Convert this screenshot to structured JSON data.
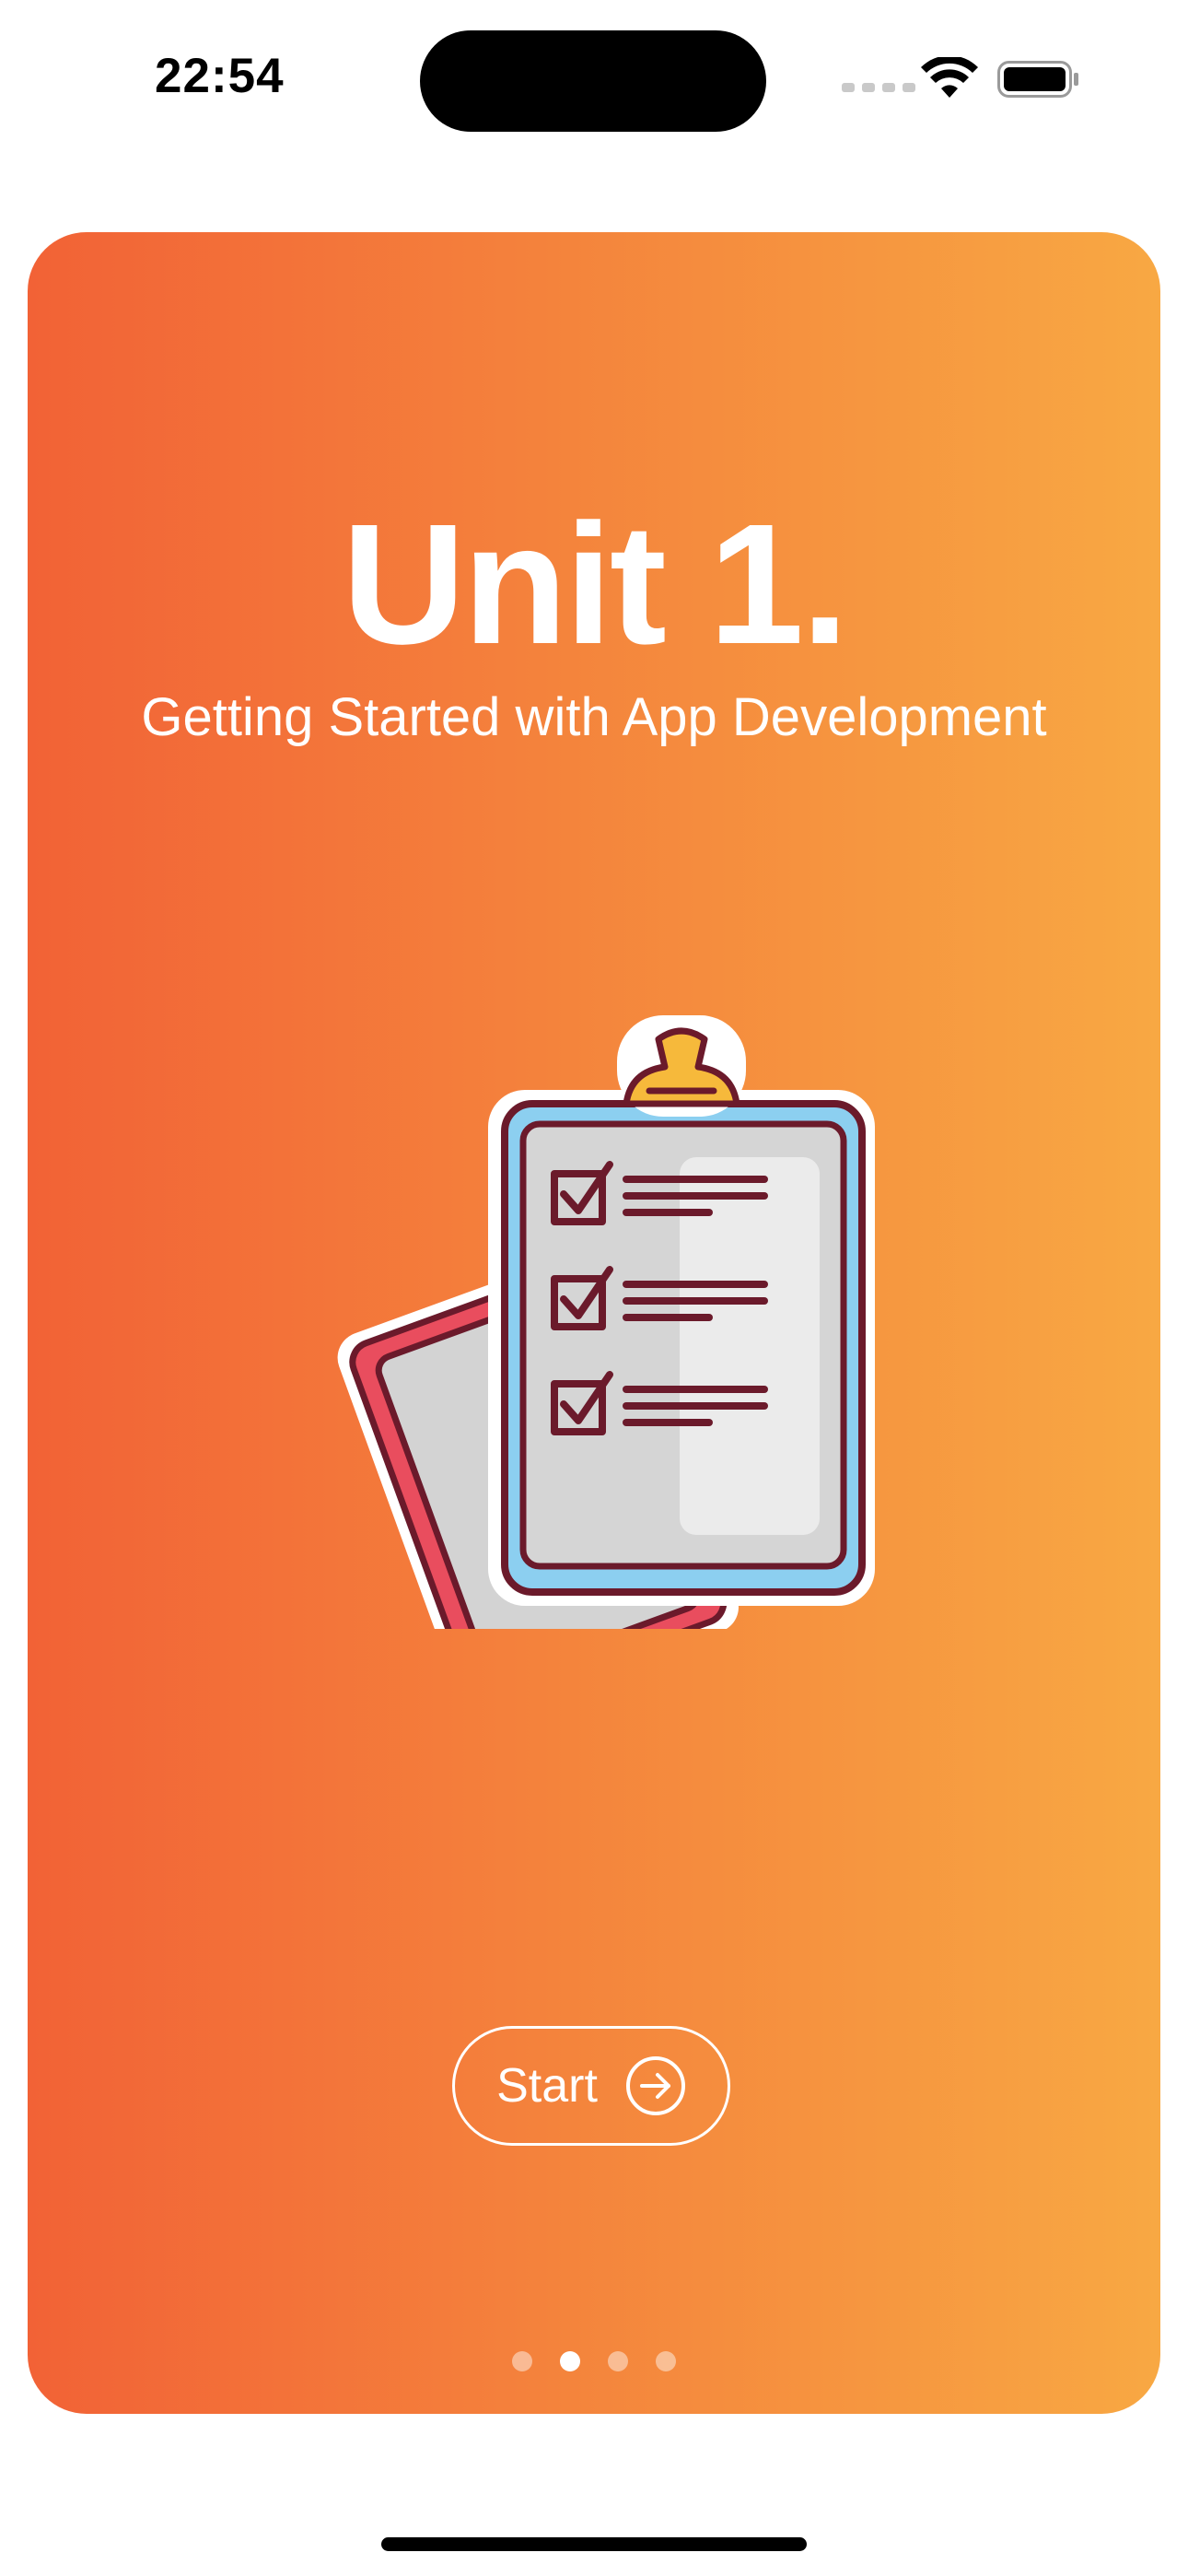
{
  "status_bar": {
    "time": "22:54"
  },
  "card": {
    "title": "Unit 1.",
    "subtitle": "Getting Started with App Development",
    "start_button": {
      "label": "Start",
      "icon": "arrow-right-circle-icon"
    },
    "illustration_icon": "clipboard-checklist-icon",
    "page_indicator": {
      "total": 4,
      "current": 2
    }
  },
  "colors": {
    "gradient_start": "#f26236",
    "gradient_end": "#f8a843",
    "text": "#ffffff"
  }
}
